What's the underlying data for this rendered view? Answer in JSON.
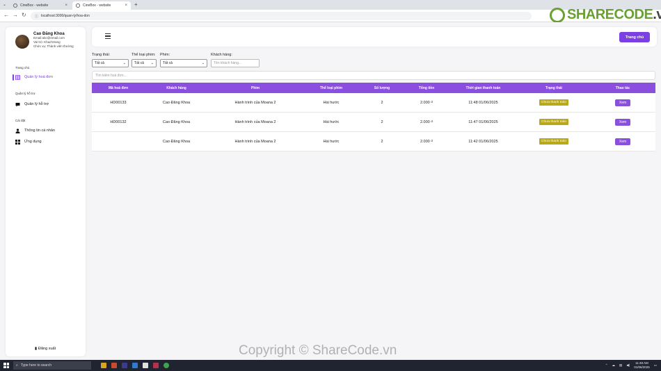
{
  "browser": {
    "tabs": [
      {
        "title": "CineBox - website"
      },
      {
        "title": "CineBox - website"
      }
    ],
    "new_tab": "+",
    "url": "localhost:3000/quan-ly/hoa-don"
  },
  "watermark": {
    "logo_green": "SHARECODE",
    "logo_dark": ".vn",
    "copyright": "Copyright © ShareCode.vn"
  },
  "sidebar": {
    "user": {
      "name": "Cao Đăng Khoa",
      "email": "Email:abc@email.com",
      "role": "Vai trò: KhachHang",
      "position": "Chức vụ: Thành viên thường"
    },
    "sections": [
      {
        "title": "Trang chủ",
        "items": [
          {
            "label": "Quản lý hoá đơn",
            "icon": "table-grid-icon",
            "active": true
          }
        ]
      },
      {
        "title": "Quản lý hỗ trợ",
        "items": [
          {
            "label": "Quản lý hỗ trợ",
            "icon": "chat-bubble-icon",
            "active": false
          }
        ]
      },
      {
        "title": "Cài đặt",
        "items": [
          {
            "label": "Thông tin cá nhân",
            "icon": "user-icon",
            "active": false
          },
          {
            "label": "Ứng dụng",
            "icon": "apps-grid-icon",
            "active": false
          }
        ]
      }
    ],
    "logout_label": "Đăng xuất"
  },
  "topbar": {
    "home_button": "Trang chủ"
  },
  "filters": {
    "status": {
      "label": "Trạng thái:",
      "value": "Tất cả"
    },
    "genre": {
      "label": "Thể loại phim:",
      "value": "Tất cả"
    },
    "movie": {
      "label": "Phim:",
      "value": "Tất cả"
    },
    "customer": {
      "label": "Khách hàng:",
      "placeholder": "Tên khách hàng..."
    }
  },
  "search": {
    "placeholder": "Tìm kiếm hoá đơn..."
  },
  "table": {
    "headers": [
      "Mã hoá đơn",
      "Khách hàng",
      "Phim",
      "Thể loại phim",
      "Số lượng",
      "Tổng tiền",
      "Thời gian thanh toán",
      "Trạng thái",
      "Thao tác"
    ],
    "rows": [
      {
        "id": "HD00133",
        "customer": "Cao Đăng Khoa",
        "movie": "Hành trình của Moana 2",
        "genre": "Hài hước",
        "qty": "2",
        "total": "2.000 ₫",
        "time": "11:48 01/06/2025",
        "status": "Chưa thanh toán",
        "action": "Xem"
      },
      {
        "id": "HD00132",
        "customer": "Cao Đăng Khoa",
        "movie": "Hành trình của Moana 2",
        "genre": "Hài hước",
        "qty": "2",
        "total": "2.000 ₫",
        "time": "11:47 01/06/2025",
        "status": "Chưa thanh toán",
        "action": "Xem"
      },
      {
        "id": "",
        "customer": "Cao Đăng Khoa",
        "movie": "Hành trình của Moana 2",
        "genre": "Hài hước",
        "qty": "2",
        "total": "2.000 ₫",
        "time": "11:42 01/06/2025",
        "status": "Chưa thanh toán",
        "action": "Xem"
      }
    ]
  },
  "taskbar": {
    "search_placeholder": "Type here to search",
    "time": "11:48 AM",
    "date": "01/06/2025"
  },
  "colors": {
    "accent": "#8b4fe0",
    "status_badge": "#b8a81a"
  }
}
